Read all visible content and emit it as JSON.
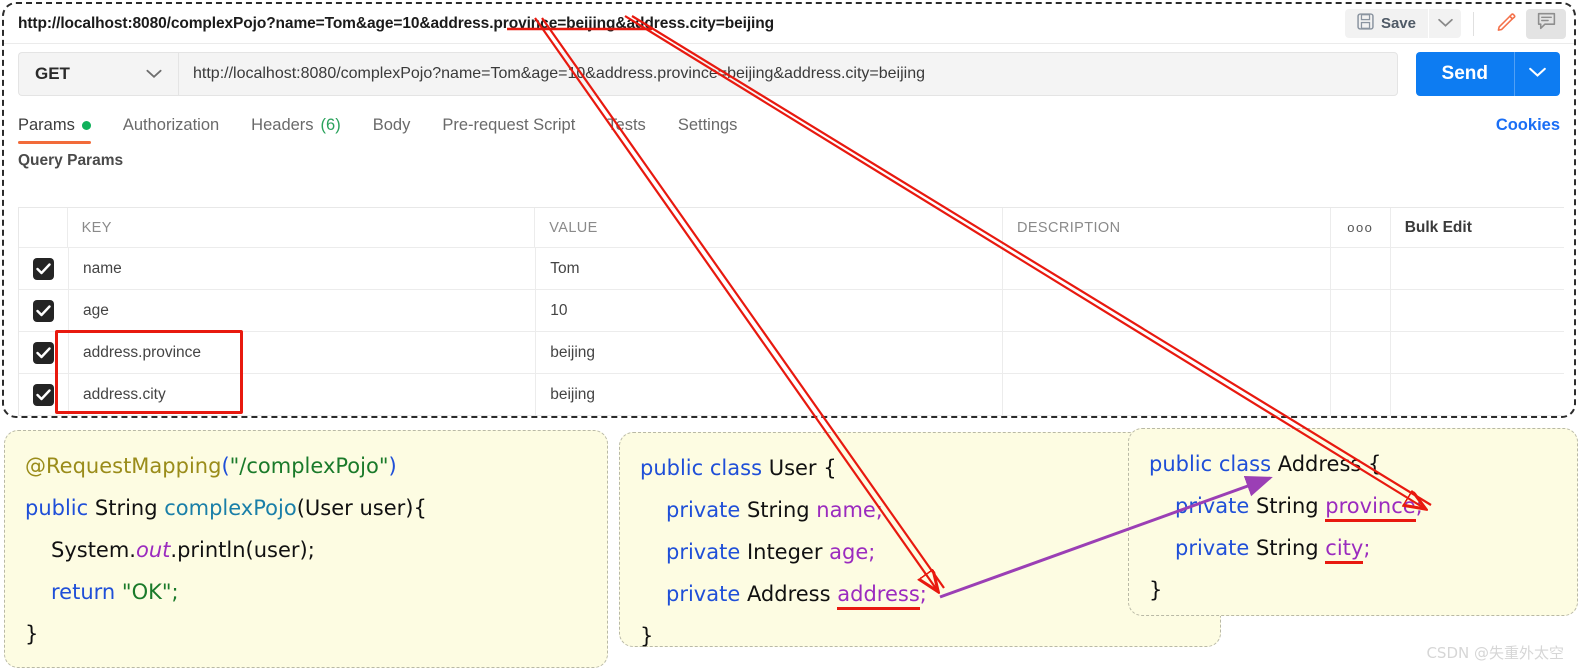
{
  "request": {
    "title": "http://localhost:8080/complexPojo?name=Tom&age=10&address.province=beijing&address.city=beijing",
    "method": "GET",
    "url": "http://localhost:8080/complexPojo?name=Tom&age=10&address.province=beijing&address.city=beijing",
    "save_label": "Save",
    "send_label": "Send"
  },
  "tabs": [
    {
      "label": "Params",
      "badge": "dot",
      "active": true
    },
    {
      "label": "Authorization",
      "badge": "",
      "active": false
    },
    {
      "label": "Headers",
      "badge": "(6)",
      "active": false
    },
    {
      "label": "Body",
      "badge": "",
      "active": false
    },
    {
      "label": "Pre-request Script",
      "badge": "",
      "active": false
    },
    {
      "label": "Tests",
      "badge": "",
      "active": false
    },
    {
      "label": "Settings",
      "badge": "",
      "active": false
    }
  ],
  "cookies_label": "Cookies",
  "params": {
    "section_title": "Query Params",
    "headers": {
      "key": "KEY",
      "value": "VALUE",
      "description": "DESCRIPTION",
      "bulk_edit": "Bulk Edit",
      "more": "ooo"
    },
    "rows": [
      {
        "checked": true,
        "key": "name",
        "value": "Tom",
        "description": ""
      },
      {
        "checked": true,
        "key": "age",
        "value": "10",
        "description": ""
      },
      {
        "checked": true,
        "key": "address.province",
        "value": "beijing",
        "description": ""
      },
      {
        "checked": true,
        "key": "address.city",
        "value": "beijing",
        "description": ""
      }
    ]
  },
  "code_panels": {
    "controller": {
      "line1_annotation": "@RequestMapping",
      "line1_arg": "\"/complexPojo\"",
      "line2": "public String complexPojo(User user){",
      "line3": "System.out.println(user);",
      "line4": "return \"OK\";",
      "line5": "}",
      "tokens": {
        "public": "public",
        "String": "String",
        "methodName": "complexPojo",
        "paramType": "User",
        "paramName": "user",
        "system": "System.",
        "out": "out",
        "println": ".println(user);",
        "return": "return",
        "ok": "\"OK\";",
        "close": "}"
      }
    },
    "user": {
      "decl": "public class User {",
      "fields": [
        {
          "mod": "private",
          "type": "String",
          "name": "name",
          "underline": false
        },
        {
          "mod": "private",
          "type": "Integer",
          "name": "age",
          "underline": false
        },
        {
          "mod": "private",
          "type": "Address",
          "name": "address",
          "underline": true
        }
      ],
      "close": "}",
      "kw_public": "public",
      "kw_class": "class",
      "cls_name": "User"
    },
    "address": {
      "decl": "public class Address {",
      "fields": [
        {
          "mod": "private",
          "type": "String",
          "name": "province",
          "underline": true
        },
        {
          "mod": "private",
          "type": "String",
          "name": "city",
          "underline": true
        }
      ],
      "close": "}",
      "kw_public": "public",
      "kw_class": "class",
      "cls_name": "Address"
    }
  },
  "annotations": {
    "highlight_color": "#e8190f",
    "link_color": "#9b3fb5",
    "watermark": "CSDN @失重外太空"
  },
  "colors": {
    "accent_blue": "#0d7cf2",
    "tab_underline": "#f26b3a",
    "green_dot": "#10b15b",
    "code_bg": "#fdfce2"
  }
}
